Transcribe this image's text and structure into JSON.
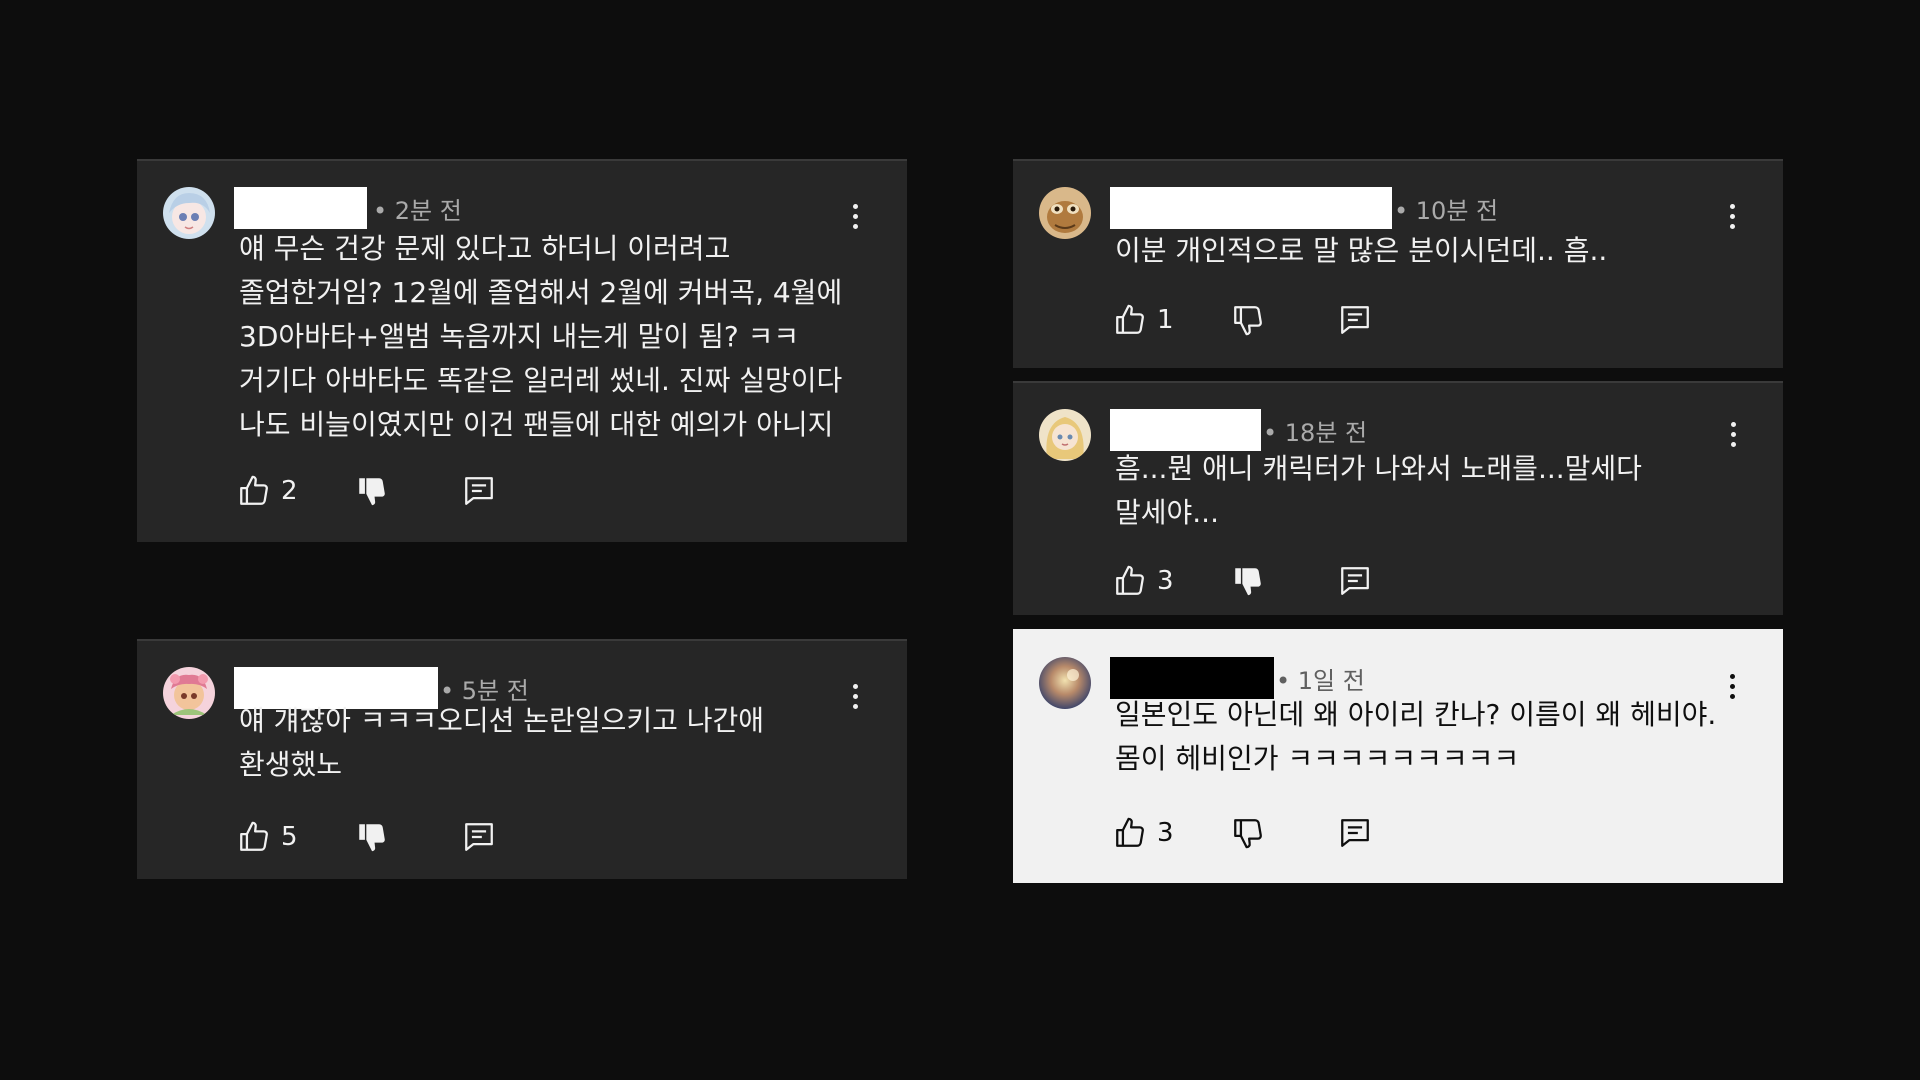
{
  "colors": {
    "background": "#0d0d0d",
    "card_dark": "#262626",
    "card_light": "#f1f1f1",
    "text_dark_mode": "#f1f1f1",
    "text_light_mode": "#0f0f0f",
    "meta_gray": "#aaaaaa"
  },
  "icons": {
    "like": "thumbs-up-icon",
    "dislike": "thumbs-down-icon",
    "reply": "reply-icon",
    "menu": "more-vertical-icon"
  },
  "comments": [
    {
      "time": "• 2분 전",
      "lines": [
        "얘 무슨 건강 문제 있다고 하더니 이러려고",
        "졸업한거임? 12월에 졸업해서 2월에 커버곡, 4월에",
        "3D아바타+앨범 녹음까지 내는게 말이 됨? ㅋㅋ",
        "거기다 아바타도 똑같은 일러레 썼네. 진짜 실망이다",
        "나도 비늘이였지만 이건 팬들에 대한 예의가 아니지"
      ],
      "likes": "2"
    },
    {
      "time": "• 5분 전",
      "lines": [
        "얘 걔잖아 ㅋㅋㅋ오디션 논란일으키고 나간애",
        "환생했노"
      ],
      "likes": "5"
    },
    {
      "time": "• 10분 전",
      "lines": [
        "이분 개인적으로 말 많은 분이시던데.. 흠.."
      ],
      "likes": "1"
    },
    {
      "time": "• 18분 전",
      "lines": [
        "흠...뭔 애니 캐릭터가 나와서 노래를...말세다",
        "말세야..."
      ],
      "likes": "3"
    },
    {
      "time": "• 1일 전",
      "lines": [
        "일본인도 아닌데 왜 아이리 칸나? 이름이 왜 헤비야.",
        "몸이 헤비인가 ㅋㅋㅋㅋㅋㅋㅋㅋㅋ"
      ],
      "likes": "3"
    }
  ]
}
